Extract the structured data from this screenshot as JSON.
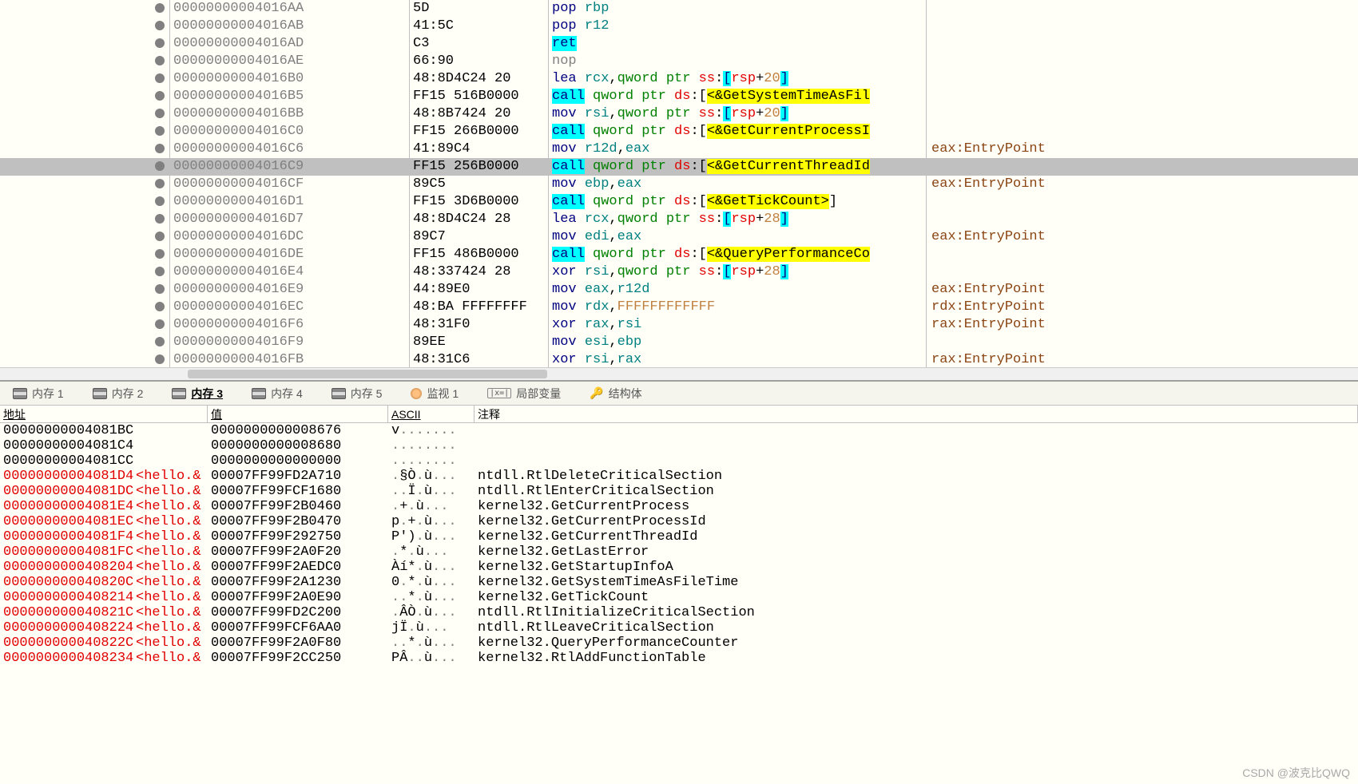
{
  "disasm": [
    {
      "addr": "00000000004016AA",
      "bytes": "5D",
      "parts": [
        {
          "t": "pop ",
          "c": "mn"
        },
        {
          "t": "rbp",
          "c": "reg"
        }
      ],
      "comment": ""
    },
    {
      "addr": "00000000004016AB",
      "bytes": "41:5C",
      "parts": [
        {
          "t": "pop ",
          "c": "mn"
        },
        {
          "t": "r12",
          "c": "reg"
        }
      ],
      "comment": ""
    },
    {
      "addr": "00000000004016AD",
      "bytes": "C3",
      "parts": [
        {
          "t": "ret",
          "c": "hl-cyan"
        }
      ],
      "comment": ""
    },
    {
      "addr": "00000000004016AE",
      "bytes": "66:90",
      "parts": [
        {
          "t": "nop",
          "c": "grey"
        }
      ],
      "comment": "",
      "grey": true
    },
    {
      "addr": "00000000004016B0",
      "bytes": "48:8D4C24 20",
      "parts": [
        {
          "t": "lea ",
          "c": "mn"
        },
        {
          "t": "rcx",
          "c": "reg"
        },
        {
          "t": ",",
          "c": ""
        },
        {
          "t": "qword ptr ",
          "c": "greentxt"
        },
        {
          "t": "ss",
          "c": "redtxt"
        },
        {
          "t": ":",
          "c": ""
        },
        {
          "t": "[",
          "c": "hl-cyan"
        },
        {
          "t": "rsp",
          "c": "redtxt"
        },
        {
          "t": "+",
          "c": ""
        },
        {
          "t": "20",
          "c": "num"
        },
        {
          "t": "]",
          "c": "hl-cyan"
        }
      ],
      "comment": ""
    },
    {
      "addr": "00000000004016B5",
      "bytes": "FF15 516B0000",
      "parts": [
        {
          "t": "call",
          "c": "hl-cyan"
        },
        {
          "t": " ",
          "c": ""
        },
        {
          "t": "qword ptr ",
          "c": "greentxt"
        },
        {
          "t": "ds",
          "c": "redtxt"
        },
        {
          "t": ":",
          "c": ""
        },
        {
          "t": "[",
          "c": ""
        },
        {
          "t": "<&GetSystemTimeAsFil",
          "c": "hl-yellow"
        }
      ],
      "comment": ""
    },
    {
      "addr": "00000000004016BB",
      "bytes": "48:8B7424 20",
      "parts": [
        {
          "t": "mov ",
          "c": "mn"
        },
        {
          "t": "rsi",
          "c": "reg"
        },
        {
          "t": ",",
          "c": ""
        },
        {
          "t": "qword ptr ",
          "c": "greentxt"
        },
        {
          "t": "ss",
          "c": "redtxt"
        },
        {
          "t": ":",
          "c": ""
        },
        {
          "t": "[",
          "c": "hl-cyan"
        },
        {
          "t": "rsp",
          "c": "redtxt"
        },
        {
          "t": "+",
          "c": ""
        },
        {
          "t": "20",
          "c": "num"
        },
        {
          "t": "]",
          "c": "hl-cyan"
        }
      ],
      "comment": ""
    },
    {
      "addr": "00000000004016C0",
      "bytes": "FF15 266B0000",
      "parts": [
        {
          "t": "call",
          "c": "hl-cyan"
        },
        {
          "t": " ",
          "c": ""
        },
        {
          "t": "qword ptr ",
          "c": "greentxt"
        },
        {
          "t": "ds",
          "c": "redtxt"
        },
        {
          "t": ":",
          "c": ""
        },
        {
          "t": "[",
          "c": ""
        },
        {
          "t": "<&GetCurrentProcessI",
          "c": "hl-yellow"
        }
      ],
      "comment": ""
    },
    {
      "addr": "00000000004016C6",
      "bytes": "41:89C4",
      "parts": [
        {
          "t": "mov ",
          "c": "mn"
        },
        {
          "t": "r12d",
          "c": "reg"
        },
        {
          "t": ",",
          "c": ""
        },
        {
          "t": "eax",
          "c": "reg"
        }
      ],
      "comment": "eax:EntryPoint"
    },
    {
      "addr": "00000000004016C9",
      "bytes": "FF15 256B0000",
      "parts": [
        {
          "t": "call",
          "c": "hl-cyan"
        },
        {
          "t": " ",
          "c": ""
        },
        {
          "t": "qword ptr ",
          "c": "greentxt"
        },
        {
          "t": "ds",
          "c": "redtxt"
        },
        {
          "t": ":",
          "c": ""
        },
        {
          "t": "[",
          "c": ""
        },
        {
          "t": "<&GetCurrentThreadId",
          "c": "hl-yellow"
        }
      ],
      "comment": "",
      "selected": true
    },
    {
      "addr": "00000000004016CF",
      "bytes": "89C5",
      "parts": [
        {
          "t": "mov ",
          "c": "mn"
        },
        {
          "t": "ebp",
          "c": "reg"
        },
        {
          "t": ",",
          "c": ""
        },
        {
          "t": "eax",
          "c": "reg"
        }
      ],
      "comment": "eax:EntryPoint"
    },
    {
      "addr": "00000000004016D1",
      "bytes": "FF15 3D6B0000",
      "parts": [
        {
          "t": "call",
          "c": "hl-cyan"
        },
        {
          "t": " ",
          "c": ""
        },
        {
          "t": "qword ptr ",
          "c": "greentxt"
        },
        {
          "t": "ds",
          "c": "redtxt"
        },
        {
          "t": ":",
          "c": ""
        },
        {
          "t": "[",
          "c": ""
        },
        {
          "t": "<&GetTickCount>",
          "c": "hl-yellow"
        },
        {
          "t": "]",
          "c": ""
        }
      ],
      "comment": ""
    },
    {
      "addr": "00000000004016D7",
      "bytes": "48:8D4C24 28",
      "parts": [
        {
          "t": "lea ",
          "c": "mn"
        },
        {
          "t": "rcx",
          "c": "reg"
        },
        {
          "t": ",",
          "c": ""
        },
        {
          "t": "qword ptr ",
          "c": "greentxt"
        },
        {
          "t": "ss",
          "c": "redtxt"
        },
        {
          "t": ":",
          "c": ""
        },
        {
          "t": "[",
          "c": "hl-cyan"
        },
        {
          "t": "rsp",
          "c": "redtxt"
        },
        {
          "t": "+",
          "c": ""
        },
        {
          "t": "28",
          "c": "num"
        },
        {
          "t": "]",
          "c": "hl-cyan"
        }
      ],
      "comment": ""
    },
    {
      "addr": "00000000004016DC",
      "bytes": "89C7",
      "parts": [
        {
          "t": "mov ",
          "c": "mn"
        },
        {
          "t": "edi",
          "c": "reg"
        },
        {
          "t": ",",
          "c": ""
        },
        {
          "t": "eax",
          "c": "reg"
        }
      ],
      "comment": "eax:EntryPoint"
    },
    {
      "addr": "00000000004016DE",
      "bytes": "FF15 486B0000",
      "parts": [
        {
          "t": "call",
          "c": "hl-cyan"
        },
        {
          "t": " ",
          "c": ""
        },
        {
          "t": "qword ptr ",
          "c": "greentxt"
        },
        {
          "t": "ds",
          "c": "redtxt"
        },
        {
          "t": ":",
          "c": ""
        },
        {
          "t": "[",
          "c": ""
        },
        {
          "t": "<&QueryPerformanceCo",
          "c": "hl-yellow"
        }
      ],
      "comment": ""
    },
    {
      "addr": "00000000004016E4",
      "bytes": "48:337424 28",
      "parts": [
        {
          "t": "xor ",
          "c": "mn"
        },
        {
          "t": "rsi",
          "c": "reg"
        },
        {
          "t": ",",
          "c": ""
        },
        {
          "t": "qword ptr ",
          "c": "greentxt"
        },
        {
          "t": "ss",
          "c": "redtxt"
        },
        {
          "t": ":",
          "c": ""
        },
        {
          "t": "[",
          "c": "hl-cyan"
        },
        {
          "t": "rsp",
          "c": "redtxt"
        },
        {
          "t": "+",
          "c": ""
        },
        {
          "t": "28",
          "c": "num"
        },
        {
          "t": "]",
          "c": "hl-cyan"
        }
      ],
      "comment": ""
    },
    {
      "addr": "00000000004016E9",
      "bytes": "44:89E0",
      "parts": [
        {
          "t": "mov ",
          "c": "mn"
        },
        {
          "t": "eax",
          "c": "reg"
        },
        {
          "t": ",",
          "c": ""
        },
        {
          "t": "r12d",
          "c": "reg"
        }
      ],
      "comment": "eax:EntryPoint"
    },
    {
      "addr": "00000000004016EC",
      "bytes": "48:BA FFFFFFFF",
      "parts": [
        {
          "t": "mov ",
          "c": "mn"
        },
        {
          "t": "rdx",
          "c": "reg"
        },
        {
          "t": ",",
          "c": ""
        },
        {
          "t": "FFFFFFFFFFFF",
          "c": "num"
        }
      ],
      "comment": "rdx:EntryPoint"
    },
    {
      "addr": "00000000004016F6",
      "bytes": "48:31F0",
      "parts": [
        {
          "t": "xor ",
          "c": "mn"
        },
        {
          "t": "rax",
          "c": "reg"
        },
        {
          "t": ",",
          "c": ""
        },
        {
          "t": "rsi",
          "c": "reg"
        }
      ],
      "comment": "rax:EntryPoint"
    },
    {
      "addr": "00000000004016F9",
      "bytes": "89EE",
      "parts": [
        {
          "t": "mov ",
          "c": "mn"
        },
        {
          "t": "esi",
          "c": "reg"
        },
        {
          "t": ",",
          "c": ""
        },
        {
          "t": "ebp",
          "c": "reg"
        }
      ],
      "comment": ""
    },
    {
      "addr": "00000000004016FB",
      "bytes": "48:31C6",
      "parts": [
        {
          "t": "xor ",
          "c": "mn"
        },
        {
          "t": "rsi",
          "c": "reg"
        },
        {
          "t": ",",
          "c": ""
        },
        {
          "t": "rax",
          "c": "reg"
        }
      ],
      "comment": "rax:EntryPoint"
    }
  ],
  "tabs": [
    {
      "label": "内存 1",
      "icon": "mem",
      "active": false
    },
    {
      "label": "内存 2",
      "icon": "mem",
      "active": false
    },
    {
      "label": "内存 3",
      "icon": "mem",
      "active": true
    },
    {
      "label": "内存 4",
      "icon": "mem",
      "active": false
    },
    {
      "label": "内存 5",
      "icon": "mem",
      "active": false
    },
    {
      "label": "监视 1",
      "icon": "watch",
      "active": false
    },
    {
      "label": "局部变量",
      "icon": "local",
      "active": false
    },
    {
      "label": "结构体",
      "icon": "struct",
      "active": false
    }
  ],
  "dump_headers": {
    "addr": "地址",
    "val": "值",
    "ascii": "ASCII",
    "comm": "注释"
  },
  "dump": [
    {
      "addr": "00000000004081BC",
      "label": "",
      "val": "0000000000008676",
      "ascii": "v.......",
      "comm": "",
      "red": false
    },
    {
      "addr": "00000000004081C4",
      "label": "",
      "val": "0000000000008680",
      "ascii": "........",
      "comm": "",
      "red": false
    },
    {
      "addr": "00000000004081CC",
      "label": "",
      "val": "0000000000000000",
      "ascii": "........",
      "comm": "",
      "red": false
    },
    {
      "addr": "00000000004081D4",
      "label": "<hello.&",
      "val": "00007FF99FD2A710",
      "ascii": ".§Ò.ù...",
      "comm": "ntdll.RtlDeleteCriticalSection",
      "red": true
    },
    {
      "addr": "00000000004081DC",
      "label": "<hello.&",
      "val": "00007FF99FCF1680",
      "ascii": "..Ï.ù...",
      "comm": "ntdll.RtlEnterCriticalSection",
      "red": true
    },
    {
      "addr": "00000000004081E4",
      "label": "<hello.&",
      "val": "00007FF99F2B0460",
      "ascii": " .+.ù...",
      "comm": "kernel32.GetCurrentProcess",
      "red": true
    },
    {
      "addr": "00000000004081EC",
      "label": "<hello.&",
      "val": "00007FF99F2B0470",
      "ascii": "p.+.ù...",
      "comm": "kernel32.GetCurrentProcessId",
      "red": true
    },
    {
      "addr": "00000000004081F4",
      "label": "<hello.&",
      "val": "00007FF99F292750",
      "ascii": "P').ù...",
      "comm": "kernel32.GetCurrentThreadId",
      "red": true
    },
    {
      "addr": "00000000004081FC",
      "label": "<hello.&",
      "val": "00007FF99F2A0F20",
      "ascii": " .*.ù...",
      "comm": "kernel32.GetLastError",
      "red": true
    },
    {
      "addr": "0000000000408204",
      "label": "<hello.&",
      "val": "00007FF99F2AEDC0",
      "ascii": "Àí*.ù...",
      "comm": "kernel32.GetStartupInfoA",
      "red": true
    },
    {
      "addr": "000000000040820C",
      "label": "<hello.&",
      "val": "00007FF99F2A1230",
      "ascii": "0.*.ù...",
      "comm": "kernel32.GetSystemTimeAsFileTime",
      "red": true
    },
    {
      "addr": "0000000000408214",
      "label": "<hello.&",
      "val": "00007FF99F2A0E90",
      "ascii": "..*.ù...",
      "comm": "kernel32.GetTickCount",
      "red": true
    },
    {
      "addr": "000000000040821C",
      "label": "<hello.&",
      "val": "00007FF99FD2C200",
      "ascii": ".ÂÒ.ù...",
      "comm": "ntdll.RtlInitializeCriticalSection",
      "red": true
    },
    {
      "addr": "0000000000408224",
      "label": "<hello.&",
      "val": "00007FF99FCF6AA0",
      "ascii": " jÏ.ù...",
      "comm": "ntdll.RtlLeaveCriticalSection",
      "red": true
    },
    {
      "addr": "000000000040822C",
      "label": "<hello.&",
      "val": "00007FF99F2A0F80",
      "ascii": "..*.ù...",
      "comm": "kernel32.QueryPerformanceCounter",
      "red": true
    },
    {
      "addr": "0000000000408234",
      "label": "<hello.&",
      "val": "00007FF99F2CC250",
      "ascii": "PÂ..ù...",
      "comm": "kernel32.RtlAddFunctionTable",
      "red": true
    }
  ],
  "watermark": "CSDN @波克比QWQ"
}
